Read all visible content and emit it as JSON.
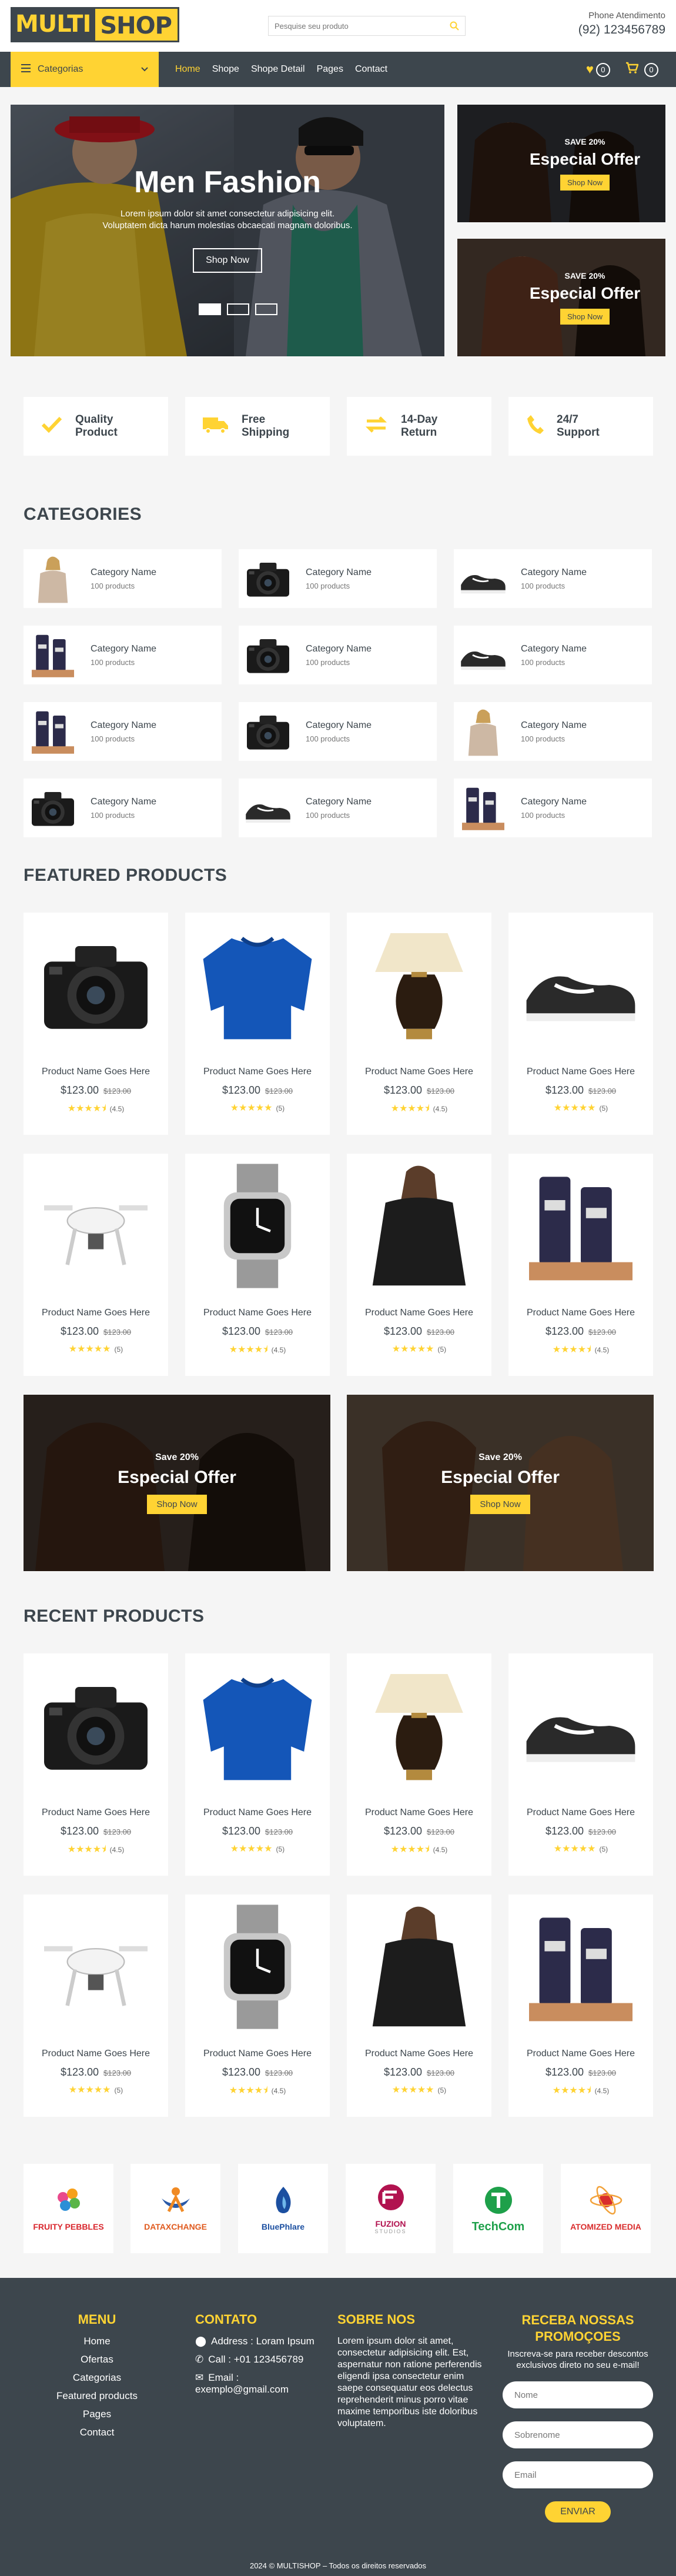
{
  "header": {
    "logo_part1": "MULTI",
    "logo_part2": "SHOP",
    "search_placeholder": "Pesquise seu produto",
    "phone_label": "Phone Atendimento",
    "phone_number": "(92) 123456789"
  },
  "nav": {
    "categories_label": "Categorias",
    "menu": [
      "Home",
      "Shope",
      "Shope Detail",
      "Pages",
      "Contact"
    ],
    "active": "Home",
    "wishlist_count": "0",
    "cart_count": "0"
  },
  "hero": {
    "title": "Men Fashion",
    "text": "Lorem ipsum dolor sit amet consectetur adipisicing elit. Voluptatem dicta harum molestias obcaecati magnam doloribus.",
    "button": "Shop Now",
    "slides": 3,
    "active_slide": 0
  },
  "side_offers": [
    {
      "save": "SAVE 20%",
      "title": "Especial Offer",
      "button": "Shop Now"
    },
    {
      "save": "SAVE 20%",
      "title": "Especial Offer",
      "button": "Shop Now"
    }
  ],
  "features": [
    {
      "icon": "check-icon",
      "label": "Quality Product"
    },
    {
      "icon": "truck-icon",
      "label": "Free Shipping"
    },
    {
      "icon": "exchange-icon",
      "label": "14-Day Return"
    },
    {
      "icon": "phone-icon",
      "label": "24/7 Support"
    }
  ],
  "categories": {
    "title": "CATEGORIES",
    "items": [
      {
        "name": "Category Name",
        "count": "100 products",
        "image": "woman-sweater"
      },
      {
        "name": "Category Name",
        "count": "100 products",
        "image": "camera"
      },
      {
        "name": "Category Name",
        "count": "100 products",
        "image": "shoes"
      },
      {
        "name": "Category Name",
        "count": "100 products",
        "image": "cosmetics"
      },
      {
        "name": "Category Name",
        "count": "100 products",
        "image": "camera"
      },
      {
        "name": "Category Name",
        "count": "100 products",
        "image": "shoes"
      },
      {
        "name": "Category Name",
        "count": "100 products",
        "image": "cosmetics"
      },
      {
        "name": "Category Name",
        "count": "100 products",
        "image": "camera"
      },
      {
        "name": "Category Name",
        "count": "100 products",
        "image": "woman-sweater"
      },
      {
        "name": "Category Name",
        "count": "100 products",
        "image": "camera"
      },
      {
        "name": "Category Name",
        "count": "100 products",
        "image": "shoes"
      },
      {
        "name": "Category Name",
        "count": "100 products",
        "image": "cosmetics"
      }
    ]
  },
  "featured": {
    "title": "FEATURED PRODUCTS",
    "items": [
      {
        "name": "Product Name Goes Here",
        "price": "$123.00",
        "old": "$123.00",
        "rating": 4.5,
        "reviews": "(4.5)",
        "image": "camera"
      },
      {
        "name": "Product Name Goes Here",
        "price": "$123.00",
        "old": "$123.00",
        "rating": 5,
        "reviews": "(5)",
        "image": "sweater"
      },
      {
        "name": "Product Name Goes Here",
        "price": "$123.00",
        "old": "$123.00",
        "rating": 4.5,
        "reviews": "(4.5)",
        "image": "lamp"
      },
      {
        "name": "Product Name Goes Here",
        "price": "$123.00",
        "old": "$123.00",
        "rating": 5,
        "reviews": "(5)",
        "image": "shoes"
      },
      {
        "name": "Product Name Goes Here",
        "price": "$123.00",
        "old": "$123.00",
        "rating": 5,
        "reviews": "(5)",
        "image": "drone"
      },
      {
        "name": "Product Name Goes Here",
        "price": "$123.00",
        "old": "$123.00",
        "rating": 4.5,
        "reviews": "(4.5)",
        "image": "watch"
      },
      {
        "name": "Product Name Goes Here",
        "price": "$123.00",
        "old": "$123.00",
        "rating": 5,
        "reviews": "(5)",
        "image": "blouse"
      },
      {
        "name": "Product Name Goes Here",
        "price": "$123.00",
        "old": "$123.00",
        "rating": 4.5,
        "reviews": "(4.5)",
        "image": "cosmetics"
      }
    ]
  },
  "big_offers": [
    {
      "save": "Save 20%",
      "title": "Especial Offer",
      "button": "Shop Now"
    },
    {
      "save": "Save 20%",
      "title": "Especial Offer",
      "button": "Shop Now"
    }
  ],
  "recent": {
    "title": "RECENT PRODUCTS",
    "items": [
      {
        "name": "Product Name Goes Here",
        "price": "$123.00",
        "old": "$123.00",
        "rating": 4.5,
        "reviews": "(4.5)",
        "image": "camera"
      },
      {
        "name": "Product Name Goes Here",
        "price": "$123.00",
        "old": "$123.00",
        "rating": 5,
        "reviews": "(5)",
        "image": "sweater"
      },
      {
        "name": "Product Name Goes Here",
        "price": "$123.00",
        "old": "$123.00",
        "rating": 4.5,
        "reviews": "(4.5)",
        "image": "lamp"
      },
      {
        "name": "Product Name Goes Here",
        "price": "$123.00",
        "old": "$123.00",
        "rating": 5,
        "reviews": "(5)",
        "image": "shoes"
      },
      {
        "name": "Product Name Goes Here",
        "price": "$123.00",
        "old": "$123.00",
        "rating": 5,
        "reviews": "(5)",
        "image": "drone"
      },
      {
        "name": "Product Name Goes Here",
        "price": "$123.00",
        "old": "$123.00",
        "rating": 4.5,
        "reviews": "(4.5)",
        "image": "watch"
      },
      {
        "name": "Product Name Goes Here",
        "price": "$123.00",
        "old": "$123.00",
        "rating": 5,
        "reviews": "(5)",
        "image": "blouse"
      },
      {
        "name": "Product Name Goes Here",
        "price": "$123.00",
        "old": "$123.00",
        "rating": 4.5,
        "reviews": "(4.5)",
        "image": "cosmetics"
      }
    ]
  },
  "vendors": [
    {
      "name": "FRUITY PEBBLES",
      "color": "#d9272e"
    },
    {
      "name": "DATAXCHANGE",
      "color": "#e05a1e"
    },
    {
      "name": "BluePhlare",
      "color": "#1b4fa0"
    },
    {
      "name": "FUZION",
      "sub": "STUDIOS",
      "color": "#b1124f"
    },
    {
      "name": "TechCom",
      "color": "#1ea04a"
    },
    {
      "name": "ATOMIZED MEDIA",
      "color": "#d92d2d"
    }
  ],
  "footer": {
    "menu_title": "MENU",
    "menu_items": [
      "Home",
      "Ofertas",
      "Categorias",
      "Featured products",
      "Pages",
      "Contact"
    ],
    "contact_title": "CONTATO",
    "address": "Address : Loram Ipsum",
    "call": "Call : +01 123456789",
    "email_label": "Email :",
    "email": "exemplo@gmail.com",
    "about_title": "SOBRE NOS",
    "about_text": "Lorem ipsum dolor sit amet, consectetur adipisicing elit. Est, aspernatur non ratione perferendis eligendi ipsa consectetur enim saepe consequatur eos delectus reprehenderit minus porro vitae maxime temporibus iste doloribus voluptatem.",
    "newsletter_title": "RECEBA NOSSAS PROMOÇOES",
    "newsletter_text": "Inscreva-se para receber descontos exclusivos direto no seu e-mail!",
    "name_placeholder": "Nome",
    "surname_placeholder": "Sobrenome",
    "email_placeholder": "Email",
    "send": "ENVIAR",
    "copyright": "2024 © MULTISHOP – Todos os direitos reservados"
  }
}
